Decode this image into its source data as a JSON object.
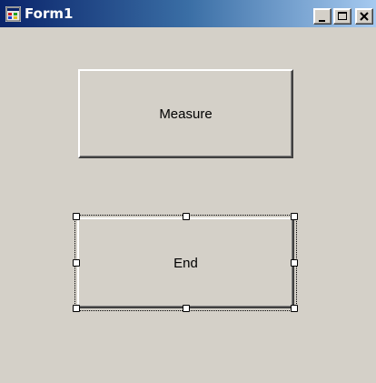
{
  "window": {
    "title": "Form1",
    "controls": [
      "minimize",
      "maximize",
      "close"
    ]
  },
  "form": {
    "buttons": [
      {
        "label": "Measure",
        "selected": false
      },
      {
        "label": "End",
        "selected": true
      }
    ]
  },
  "icons": {
    "app": "windows-form-icon",
    "minimize": "minimize-icon",
    "maximize": "maximize-icon",
    "close": "close-icon"
  },
  "colors": {
    "titlebar_start": "#0a246a",
    "titlebar_end": "#a6caf0",
    "face": "#d4d0c8"
  }
}
